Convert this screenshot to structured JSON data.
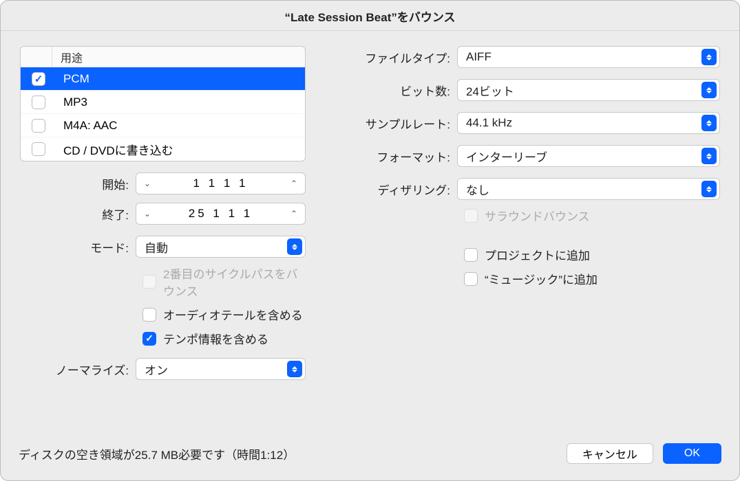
{
  "title": "“Late Session Beat”をバウンス",
  "list": {
    "header": "用途",
    "items": [
      {
        "label": "PCM",
        "checked": true,
        "selected": true
      },
      {
        "label": "MP3",
        "checked": false,
        "selected": false
      },
      {
        "label": "M4A: AAC",
        "checked": false,
        "selected": false
      },
      {
        "label": "CD / DVDに書き込む",
        "checked": false,
        "selected": false
      }
    ]
  },
  "left": {
    "start_label": "開始:",
    "start_value": "1 1 1    1",
    "end_label": "終了:",
    "end_value": "25 1 1    1",
    "mode_label": "モード:",
    "mode_value": "自動",
    "cycle2_label": "2番目のサイクルパスをバウンス",
    "tail_label": "オーディオテールを含める",
    "tempo_label": "テンポ情報を含める",
    "normalize_label": "ノーマライズ:",
    "normalize_value": "オン"
  },
  "right": {
    "filetype_label": "ファイルタイプ:",
    "filetype_value": "AIFF",
    "bitdepth_label": "ビット数:",
    "bitdepth_value": "24ビット",
    "samplerate_label": "サンプルレート:",
    "samplerate_value": "44.1 kHz",
    "format_label": "フォーマット:",
    "format_value": "インターリーブ",
    "dither_label": "ディザリング:",
    "dither_value": "なし",
    "surround_label": "サラウンドバウンス",
    "addproj_label": "プロジェクトに追加",
    "addmusic_label": "“ミュージック”に追加"
  },
  "footer": {
    "status": "ディスクの空き領域が25.7 MB必要です（時間1:12）",
    "cancel": "キャンセル",
    "ok": "OK"
  }
}
